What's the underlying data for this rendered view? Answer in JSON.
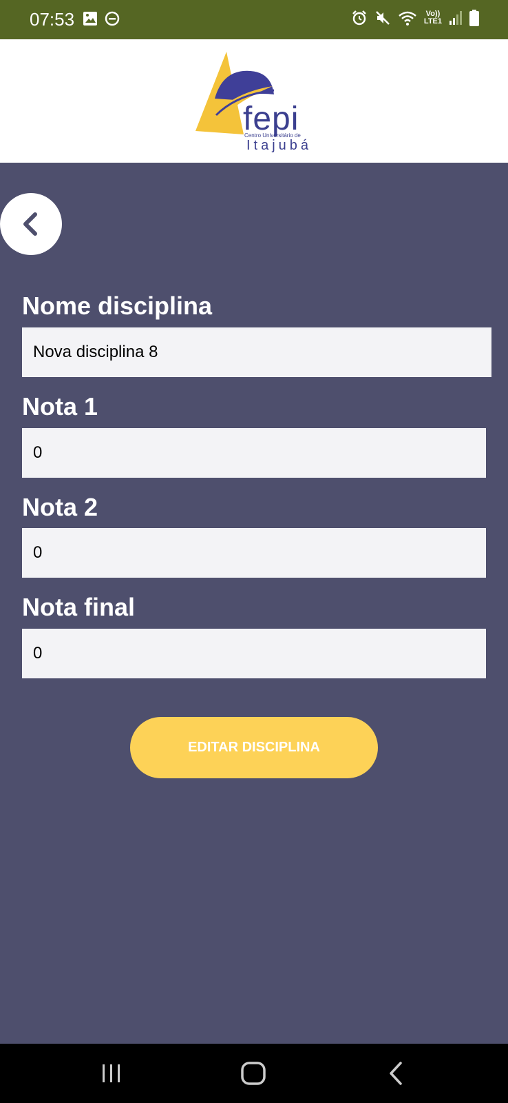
{
  "status_bar": {
    "time": "07:53",
    "lte_top": "Vo))",
    "lte_bottom": "LTE1"
  },
  "logo": {
    "name": "fepi",
    "subtitle": "Centro Universitário de",
    "city": "Itajubá"
  },
  "form": {
    "fields": [
      {
        "label": "Nome disciplina",
        "value": "Nova disciplina 8"
      },
      {
        "label": "Nota 1",
        "value": "0"
      },
      {
        "label": "Nota 2",
        "value": "0"
      },
      {
        "label": "Nota final",
        "value": "0"
      }
    ],
    "submit_label": "EDITAR DISCIPLINA"
  },
  "colors": {
    "status_bar": "#556623",
    "background": "#4e4f6d",
    "button": "#fdd257",
    "input_bg": "#f3f3f6"
  }
}
